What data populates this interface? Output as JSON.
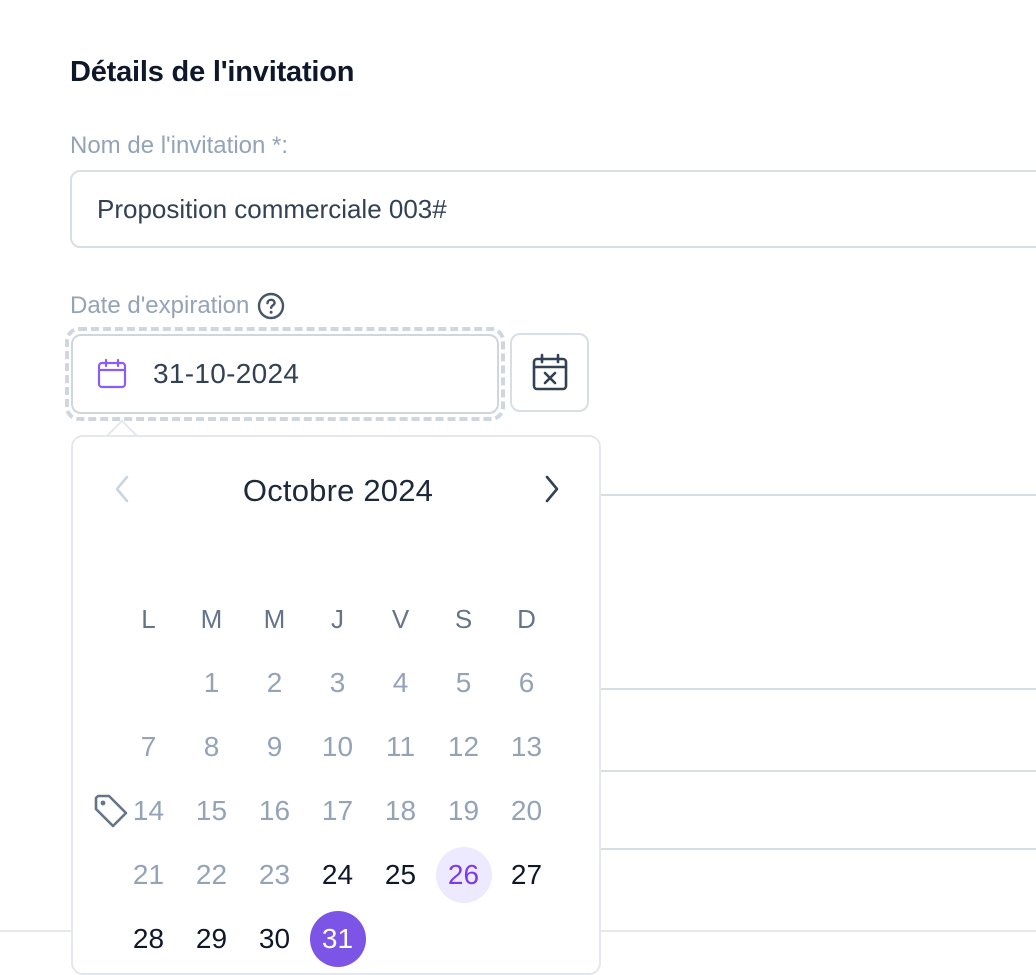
{
  "section": {
    "title": "Détails de l'invitation"
  },
  "name_field": {
    "label": "Nom de l'invitation *:",
    "value": "Proposition commerciale 003#"
  },
  "date_field": {
    "label": "Date d'expiration",
    "value": "31-10-2024"
  },
  "calendar": {
    "month_title": "Octobre 2024",
    "weekdays": [
      "L",
      "M",
      "M",
      "J",
      "V",
      "S",
      "D"
    ],
    "weeks": [
      [
        "",
        "1",
        "2",
        "3",
        "4",
        "5",
        "6"
      ],
      [
        "7",
        "8",
        "9",
        "10",
        "11",
        "12",
        "13"
      ],
      [
        "14",
        "15",
        "16",
        "17",
        "18",
        "19",
        "20"
      ],
      [
        "21",
        "22",
        "23",
        "24",
        "25",
        "26",
        "27"
      ],
      [
        "28",
        "29",
        "30",
        "31",
        "",
        "",
        ""
      ]
    ],
    "first_available_day": 24,
    "today": 26,
    "selected": 31
  },
  "colors": {
    "accent": "#7c55e6",
    "today_bg": "#ede9fe",
    "muted": "#94a3b8",
    "border": "#d9dee6"
  },
  "icons": [
    "help-icon",
    "calendar-icon",
    "calendar-clear-icon",
    "chevron-left-icon",
    "chevron-right-icon",
    "tag-icon"
  ]
}
